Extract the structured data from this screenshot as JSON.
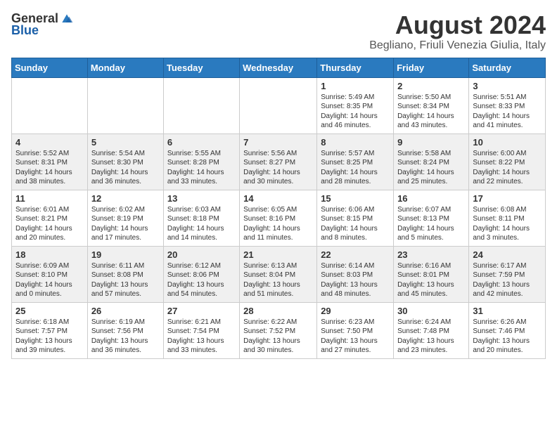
{
  "logo": {
    "general": "General",
    "blue": "Blue"
  },
  "title": {
    "month": "August 2024",
    "location": "Begliano, Friuli Venezia Giulia, Italy"
  },
  "days_of_week": [
    "Sunday",
    "Monday",
    "Tuesday",
    "Wednesday",
    "Thursday",
    "Friday",
    "Saturday"
  ],
  "weeks": [
    [
      {
        "day": "",
        "content": ""
      },
      {
        "day": "",
        "content": ""
      },
      {
        "day": "",
        "content": ""
      },
      {
        "day": "",
        "content": ""
      },
      {
        "day": "1",
        "content": "Sunrise: 5:49 AM\nSunset: 8:35 PM\nDaylight: 14 hours\nand 46 minutes."
      },
      {
        "day": "2",
        "content": "Sunrise: 5:50 AM\nSunset: 8:34 PM\nDaylight: 14 hours\nand 43 minutes."
      },
      {
        "day": "3",
        "content": "Sunrise: 5:51 AM\nSunset: 8:33 PM\nDaylight: 14 hours\nand 41 minutes."
      }
    ],
    [
      {
        "day": "4",
        "content": "Sunrise: 5:52 AM\nSunset: 8:31 PM\nDaylight: 14 hours\nand 38 minutes."
      },
      {
        "day": "5",
        "content": "Sunrise: 5:54 AM\nSunset: 8:30 PM\nDaylight: 14 hours\nand 36 minutes."
      },
      {
        "day": "6",
        "content": "Sunrise: 5:55 AM\nSunset: 8:28 PM\nDaylight: 14 hours\nand 33 minutes."
      },
      {
        "day": "7",
        "content": "Sunrise: 5:56 AM\nSunset: 8:27 PM\nDaylight: 14 hours\nand 30 minutes."
      },
      {
        "day": "8",
        "content": "Sunrise: 5:57 AM\nSunset: 8:25 PM\nDaylight: 14 hours\nand 28 minutes."
      },
      {
        "day": "9",
        "content": "Sunrise: 5:58 AM\nSunset: 8:24 PM\nDaylight: 14 hours\nand 25 minutes."
      },
      {
        "day": "10",
        "content": "Sunrise: 6:00 AM\nSunset: 8:22 PM\nDaylight: 14 hours\nand 22 minutes."
      }
    ],
    [
      {
        "day": "11",
        "content": "Sunrise: 6:01 AM\nSunset: 8:21 PM\nDaylight: 14 hours\nand 20 minutes."
      },
      {
        "day": "12",
        "content": "Sunrise: 6:02 AM\nSunset: 8:19 PM\nDaylight: 14 hours\nand 17 minutes."
      },
      {
        "day": "13",
        "content": "Sunrise: 6:03 AM\nSunset: 8:18 PM\nDaylight: 14 hours\nand 14 minutes."
      },
      {
        "day": "14",
        "content": "Sunrise: 6:05 AM\nSunset: 8:16 PM\nDaylight: 14 hours\nand 11 minutes."
      },
      {
        "day": "15",
        "content": "Sunrise: 6:06 AM\nSunset: 8:15 PM\nDaylight: 14 hours\nand 8 minutes."
      },
      {
        "day": "16",
        "content": "Sunrise: 6:07 AM\nSunset: 8:13 PM\nDaylight: 14 hours\nand 5 minutes."
      },
      {
        "day": "17",
        "content": "Sunrise: 6:08 AM\nSunset: 8:11 PM\nDaylight: 14 hours\nand 3 minutes."
      }
    ],
    [
      {
        "day": "18",
        "content": "Sunrise: 6:09 AM\nSunset: 8:10 PM\nDaylight: 14 hours\nand 0 minutes."
      },
      {
        "day": "19",
        "content": "Sunrise: 6:11 AM\nSunset: 8:08 PM\nDaylight: 13 hours\nand 57 minutes."
      },
      {
        "day": "20",
        "content": "Sunrise: 6:12 AM\nSunset: 8:06 PM\nDaylight: 13 hours\nand 54 minutes."
      },
      {
        "day": "21",
        "content": "Sunrise: 6:13 AM\nSunset: 8:04 PM\nDaylight: 13 hours\nand 51 minutes."
      },
      {
        "day": "22",
        "content": "Sunrise: 6:14 AM\nSunset: 8:03 PM\nDaylight: 13 hours\nand 48 minutes."
      },
      {
        "day": "23",
        "content": "Sunrise: 6:16 AM\nSunset: 8:01 PM\nDaylight: 13 hours\nand 45 minutes."
      },
      {
        "day": "24",
        "content": "Sunrise: 6:17 AM\nSunset: 7:59 PM\nDaylight: 13 hours\nand 42 minutes."
      }
    ],
    [
      {
        "day": "25",
        "content": "Sunrise: 6:18 AM\nSunset: 7:57 PM\nDaylight: 13 hours\nand 39 minutes."
      },
      {
        "day": "26",
        "content": "Sunrise: 6:19 AM\nSunset: 7:56 PM\nDaylight: 13 hours\nand 36 minutes."
      },
      {
        "day": "27",
        "content": "Sunrise: 6:21 AM\nSunset: 7:54 PM\nDaylight: 13 hours\nand 33 minutes."
      },
      {
        "day": "28",
        "content": "Sunrise: 6:22 AM\nSunset: 7:52 PM\nDaylight: 13 hours\nand 30 minutes."
      },
      {
        "day": "29",
        "content": "Sunrise: 6:23 AM\nSunset: 7:50 PM\nDaylight: 13 hours\nand 27 minutes."
      },
      {
        "day": "30",
        "content": "Sunrise: 6:24 AM\nSunset: 7:48 PM\nDaylight: 13 hours\nand 23 minutes."
      },
      {
        "day": "31",
        "content": "Sunrise: 6:26 AM\nSunset: 7:46 PM\nDaylight: 13 hours\nand 20 minutes."
      }
    ]
  ]
}
